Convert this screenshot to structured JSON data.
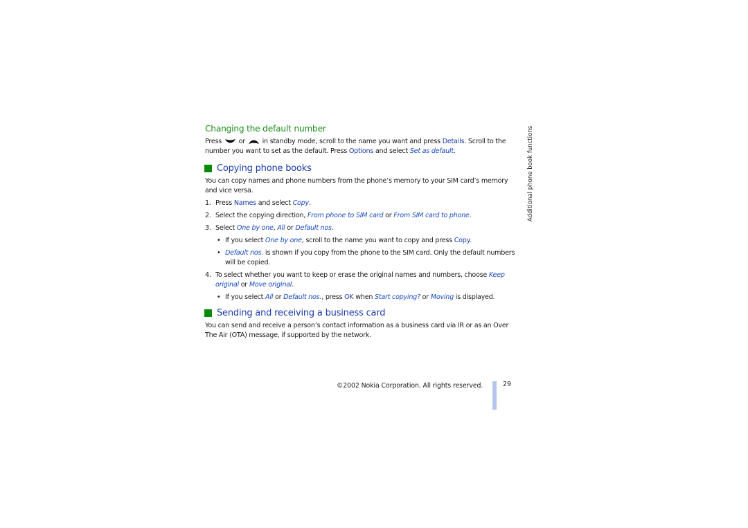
{
  "side_label": "Additional phone book functions",
  "section_default": {
    "heading": "Changing the default number",
    "p1_a": "Press",
    "icon_down": "scroll-down-key-icon",
    "p1_or": "or",
    "icon_up": "scroll-up-key-icon",
    "p1_b": "in standby mode, scroll to the name you want and press",
    "kw_details": "Details",
    "p1_c": ". Scroll to the number you want to set as the default. Press",
    "kw_options": "Options",
    "p1_d": "and select",
    "it_set_default": "Set as default",
    "p1_e": "."
  },
  "section_copy": {
    "heading": "Copying phone books",
    "intro": "You can copy names and phone numbers from the phone’s memory to your SIM card’s memory and vice versa.",
    "steps": [
      {
        "num": "1.",
        "a": "Press",
        "kw": "Names",
        "b": "and select",
        "it": "Copy",
        "c": "."
      },
      {
        "num": "2.",
        "a": "Select the copying direction,",
        "it1": "From phone to SIM card",
        "b": "or",
        "it2": "From SIM card to phone",
        "c": "."
      },
      {
        "num": "3.",
        "a": "Select",
        "it1": "One by one",
        "b": ",",
        "it2": "All",
        "c": "or",
        "it3": "Default nos",
        "d": ".",
        "bullets": [
          {
            "a": "If you select",
            "it": "One by one",
            "b": ", scroll to the name you want to copy and press",
            "kw": "Copy",
            "c": "."
          },
          {
            "it": "Default nos.",
            "a": "is shown if you copy from the phone to the SIM card. Only the default numbers will be copied."
          }
        ]
      },
      {
        "num": "4.",
        "a": "To select whether you want to keep or erase the original names and numbers, choose",
        "it1": "Keep original",
        "b": "or",
        "it2": "Move original",
        "c": ".",
        "bullets": [
          {
            "a": "If you select",
            "it1": "All",
            "b": "or",
            "it2": "Default nos.",
            "c": ", press",
            "kw": "OK",
            "d": "when",
            "it3": "Start copying?",
            "e": "or",
            "it4": "Moving",
            "f": "is displayed."
          }
        ]
      }
    ]
  },
  "section_card": {
    "heading": "Sending and receiving a business card",
    "intro": "You can send and receive a person’s contact information as a business card via IR or as an Over The Air (OTA) message, if supported by the network."
  },
  "footer": {
    "copyright": "©2002 Nokia Corporation. All rights reserved.",
    "page_number": "29"
  },
  "colors": {
    "subheading_green": "#1a8a1a",
    "heading_blue": "#1a3aa8",
    "heading_square_green": "#0a8a0a",
    "keyword_blue": "#1a3aa8",
    "italic_blue": "#1a4ac0",
    "footer_bar": "#b4c4ea"
  }
}
